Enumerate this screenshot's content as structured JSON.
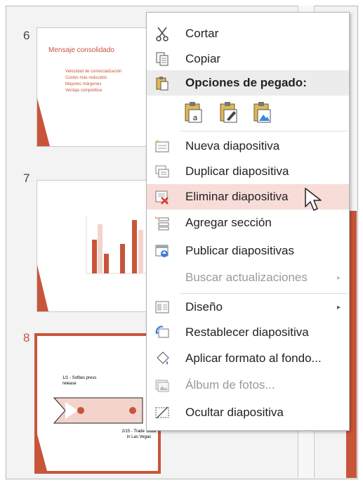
{
  "slides": [
    {
      "number": "6",
      "title": "Mensaje consolidado",
      "bullets": [
        "Velocidad de comercialización",
        "Costes más reducidos",
        "Mayores márgenes",
        "Ventaja competitiva"
      ]
    },
    {
      "number": "7"
    },
    {
      "number": "8",
      "timeline": [
        "1/1 - Softies press release",
        "2/15 - Trade Show in Las Vegas"
      ]
    }
  ],
  "menu": {
    "items": [
      {
        "label": "Cortar",
        "icon": "scissors-icon"
      },
      {
        "label": "Copiar",
        "icon": "copy-icon"
      },
      {
        "label": "Opciones de pegado:",
        "icon": "paste-icon"
      },
      {
        "label": "Nueva diapositiva",
        "icon": "new-slide-icon"
      },
      {
        "label": "Duplicar diapositiva",
        "icon": "duplicate-slide-icon"
      },
      {
        "label": "Eliminar diapositiva",
        "icon": "delete-slide-icon"
      },
      {
        "label": "Agregar sección",
        "icon": "add-section-icon"
      },
      {
        "label": "Publicar diapositivas",
        "icon": "publish-slides-icon"
      },
      {
        "label": "Buscar actualizaciones",
        "icon": "none"
      },
      {
        "label": "Diseño",
        "icon": "layout-icon"
      },
      {
        "label": "Restablecer diapositiva",
        "icon": "reset-slide-icon"
      },
      {
        "label": "Aplicar formato al fondo...",
        "icon": "format-background-icon"
      },
      {
        "label": "Álbum de fotos...",
        "icon": "photo-album-icon"
      },
      {
        "label": "Ocultar diapositiva",
        "icon": "hide-slide-icon"
      }
    ],
    "paste_options": [
      "paste-keep-text-icon",
      "paste-keep-format-icon",
      "paste-picture-icon"
    ],
    "submenu_arrow": "▸"
  },
  "colors": {
    "accent": "#c8553a",
    "highlight": "#f7dcd7",
    "disabled": "#9a9a9a"
  }
}
